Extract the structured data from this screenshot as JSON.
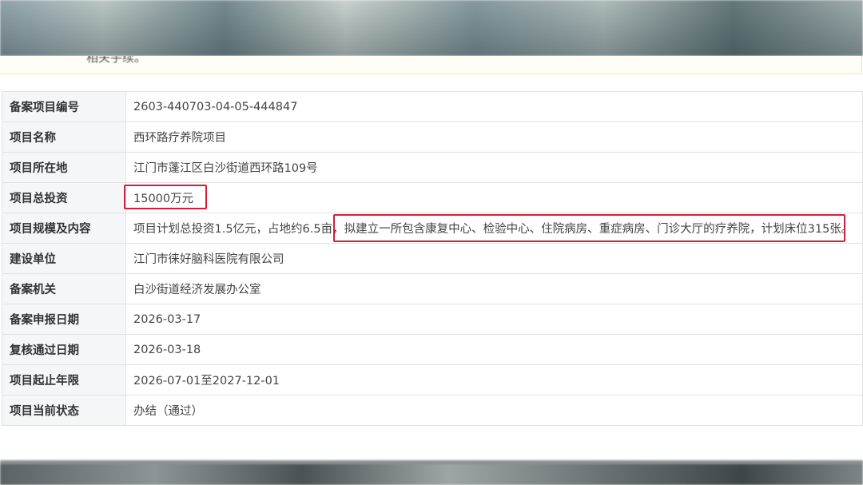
{
  "notice": {
    "text": "相关手续。"
  },
  "table": {
    "rows": [
      {
        "label": "备案项目编号",
        "value": "2603-440703-04-05-444847"
      },
      {
        "label": "项目名称",
        "value": "西环路疗养院项目"
      },
      {
        "label": "项目所在地",
        "value": "江门市蓬江区白沙街道西环路109号"
      },
      {
        "label": "项目总投资",
        "value": "15000万元"
      },
      {
        "label": "项目规模及内容",
        "value": "项目计划总投资1.5亿元，占地约6.5亩，拟建立一所包含康复中心、检验中心、住院病房、重症病房、门诊大厅的疗养院，计划床位315张。"
      },
      {
        "label": "建设单位",
        "value": "江门市徕好脑科医院有限公司"
      },
      {
        "label": "备案机关",
        "value": "白沙街道经济发展办公室"
      },
      {
        "label": "备案申报日期",
        "value": "2026-03-17"
      },
      {
        "label": "复核通过日期",
        "value": "2026-03-18"
      },
      {
        "label": "项目起止年限",
        "value": "2026-07-01至2027-12-01"
      },
      {
        "label": "项目当前状态",
        "value": "办结（通过）"
      }
    ]
  },
  "highlight_color": "#d21f3c"
}
